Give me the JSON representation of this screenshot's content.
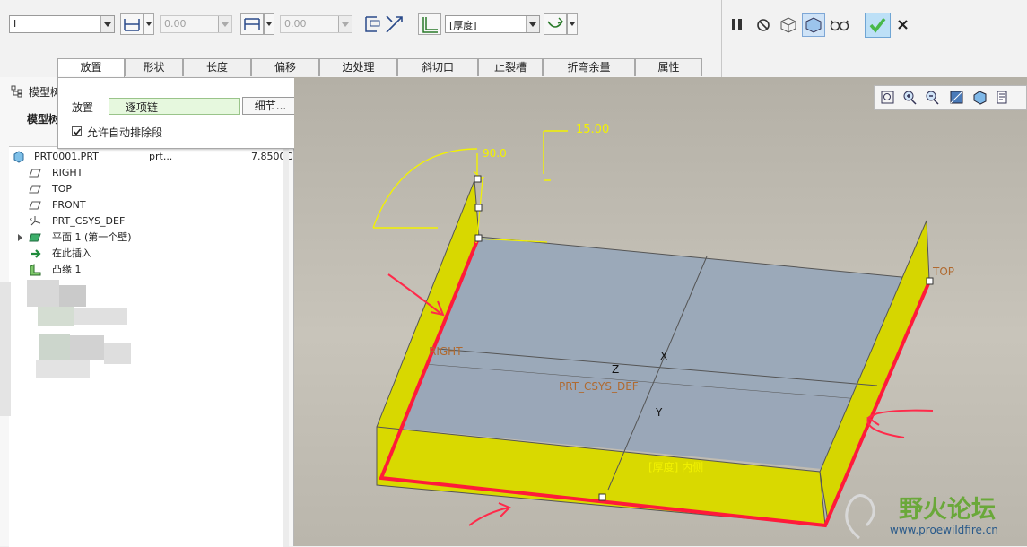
{
  "toolbar": {
    "type_value": "I",
    "length_value_1": "0.00",
    "length_value_2": "0.00",
    "thickness_side": "[厚度]"
  },
  "tabs": [
    {
      "label": "放置"
    },
    {
      "label": "形状"
    },
    {
      "label": "长度"
    },
    {
      "label": "偏移"
    },
    {
      "label": "边处理"
    },
    {
      "label": "斜切口"
    },
    {
      "label": "止裂槽"
    },
    {
      "label": "折弯余量"
    },
    {
      "label": "属性"
    }
  ],
  "placement_panel": {
    "label": "放置",
    "chain_value": "逐项链",
    "details_button": "细节...",
    "checkbox_label": "允许自动排除段",
    "checkbox_checked": true
  },
  "left_panel": {
    "header_title": "模型树",
    "subheader": "模型树"
  },
  "tree": {
    "rows": [
      {
        "label": "PRT0001.PRT",
        "col2": "prt...",
        "col3": "7.8500C"
      },
      {
        "label": "RIGHT"
      },
      {
        "label": "TOP"
      },
      {
        "label": "FRONT"
      },
      {
        "label": "PRT_CSYS_DEF"
      },
      {
        "label": "平面 1 (第一个壁)"
      },
      {
        "label": "在此插入"
      },
      {
        "label": "凸缘 1"
      }
    ]
  },
  "viewport": {
    "dim_angle": "90.0",
    "dim_length": "15.00",
    "plane_top": "TOP",
    "plane_right": "RIGHT",
    "csys": "PRT_CSYS_DEF",
    "axis_x": "X",
    "axis_y": "Y",
    "axis_z": "Z",
    "thickness_label": "[厚度] 内侧"
  },
  "watermark": {
    "title": "野火论坛",
    "url": "www.proewildfire.cn"
  },
  "colors": {
    "wall_yellow": "#d8d800",
    "base_face": "#9aa8b8",
    "highlight_red": "#ff1a3a",
    "dimension_yellow": "#f2f200",
    "accept_green": "#49b94a"
  }
}
